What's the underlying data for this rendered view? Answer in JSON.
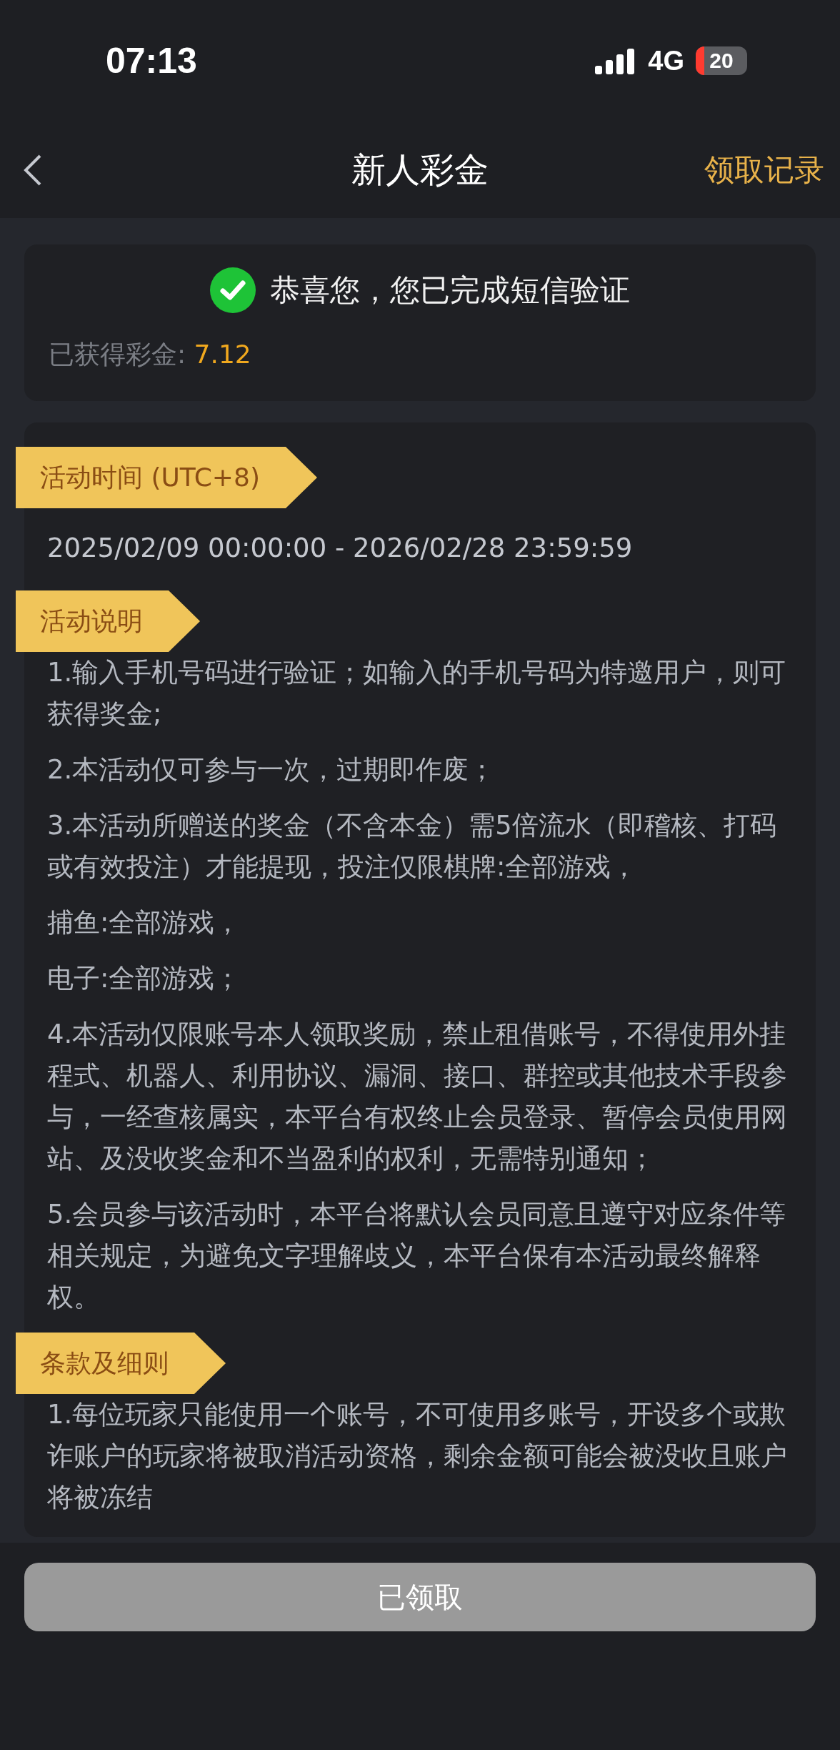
{
  "status_bar": {
    "time": "07:13",
    "network": "4G",
    "battery": "20"
  },
  "nav": {
    "title": "新人彩金",
    "action": "领取记录"
  },
  "result": {
    "message": "恭喜您，您已完成短信验证",
    "label": "已获得彩金: ",
    "value": "7.12"
  },
  "sections": [
    {
      "title": "活动时间 (UTC+8)",
      "kind": "period",
      "items": [
        "2025/02/09 00:00:00 - 2026/02/28 23:59:59"
      ]
    },
    {
      "title": "活动说明",
      "kind": "rules",
      "items": [
        "1.输入手机号码进行验证；如输入的手机号码为特邀用户，则可获得奖金;",
        "2.本活动仅可参与一次，过期即作废；",
        "3.本活动所赠送的奖金（不含本金）需5倍流水（即稽核、打码或有效投注）才能提现，投注仅限棋牌:全部游戏，",
        "捕鱼:全部游戏，",
        "电子:全部游戏；",
        "4.本活动仅限账号本人领取奖励，禁止租借账号，不得使用外挂程式、机器人、利用协议、漏洞、接口、群控或其他技术手段参与，一经查核属实，本平台有权终止会员登录、暂停会员使用网站、及没收奖金和不当盈利的权利，无需特别通知；",
        "5.会员参与该活动时，本平台将默认会员同意且遵守对应条件等相关规定，为避免文字理解歧义，本平台保有本活动最终解释权。"
      ]
    },
    {
      "title": "条款及细则",
      "kind": "rules",
      "items": [
        "1.每位玩家只能使用一个账号，不可使用多账号，开设多个或欺诈账户的玩家将被取消活动资格，剩余金额可能会被没收且账户将被冻结"
      ]
    }
  ],
  "button": {
    "label": "已领取"
  }
}
